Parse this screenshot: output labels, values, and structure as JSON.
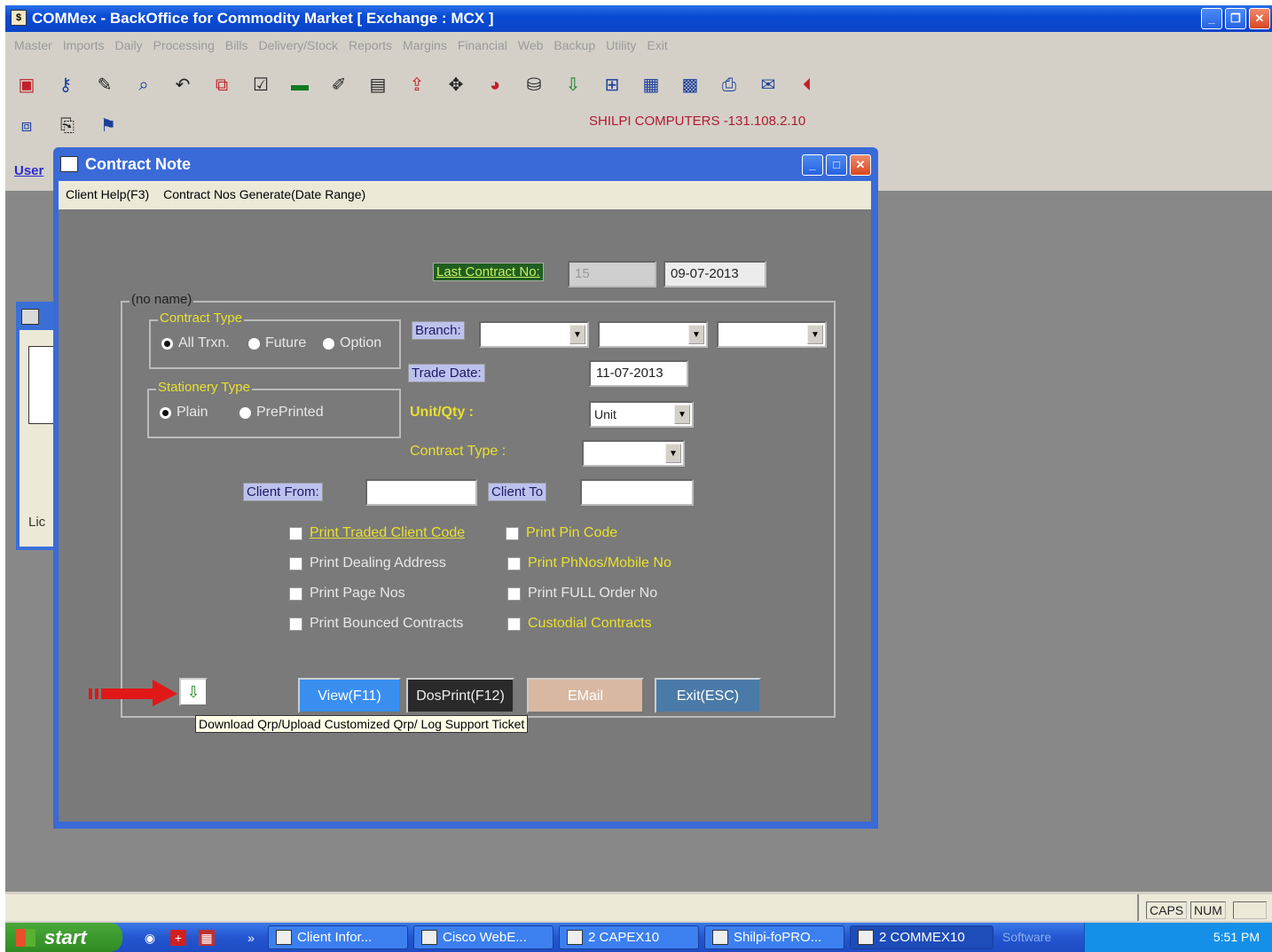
{
  "app": {
    "title": "COMMex - BackOffice for Commodity Market [ Exchange :  MCX ]",
    "menu": [
      "Master",
      "Imports",
      "Daily",
      "Processing",
      "Bills",
      "Delivery/Stock",
      "Reports",
      "Margins",
      "Financial",
      "Web",
      "Backup",
      "Utility",
      "Exit"
    ],
    "host_info": "SHILPI COMPUTERS -131.108.2.10",
    "user_label": "User"
  },
  "background_window": {
    "label": "Lic"
  },
  "dialog": {
    "title": "Contract Note",
    "menu": [
      "Client Help(F3)",
      "Contract Nos Generate(Date Range)"
    ],
    "last_contract_label": "Last Contract No:",
    "last_contract_no": "15",
    "last_contract_date": "09-07-2013",
    "group_label": "(no name)",
    "contract_type_group": {
      "legend": "Contract Type",
      "options": [
        "All Trxn.",
        "Future",
        "Option"
      ],
      "selected": "All Trxn."
    },
    "stationery_type_group": {
      "legend": "Stationery Type",
      "options": [
        "Plain",
        "PrePrinted"
      ],
      "selected": "Plain"
    },
    "branch_label": "Branch:",
    "trade_date_label": "Trade Date:",
    "trade_date": "11-07-2013",
    "unit_qty_label": "Unit/Qty :",
    "unit_qty_value": "Unit",
    "contract_type_label": "Contract Type :",
    "client_from_label": "Client From:",
    "client_to_label": "Client To",
    "checkboxes_left": [
      "Print Traded Client Code",
      "Print Dealing Address",
      "Print Page Nos",
      "Print Bounced Contracts"
    ],
    "checkboxes_right": [
      "Print Pin Code",
      "Print PhNos/Mobile No",
      "Print FULL Order No",
      "Custodial Contracts"
    ],
    "buttons": {
      "view": "View(F11)",
      "dosprint": "DosPrint(F12)",
      "email": "EMail",
      "exit": "Exit(ESC)"
    },
    "tooltip": "Download Qrp/Upload Customized Qrp/ Log Support Ticket"
  },
  "statusbar": {
    "caps": "CAPS",
    "num": "NUM"
  },
  "taskbar": {
    "start": "start",
    "tasks": [
      "Client Infor...",
      "Cisco WebE...",
      "2 CAPEX10",
      "Shilpi-foPRO...",
      "2 COMMEX10"
    ],
    "software": "Software",
    "clock": "5:51 PM"
  },
  "colors": {
    "title_blue": "#0a4bd4",
    "work_gray": "#888888",
    "label_yellow": "#e8e030",
    "host_red": "#b01a30"
  }
}
